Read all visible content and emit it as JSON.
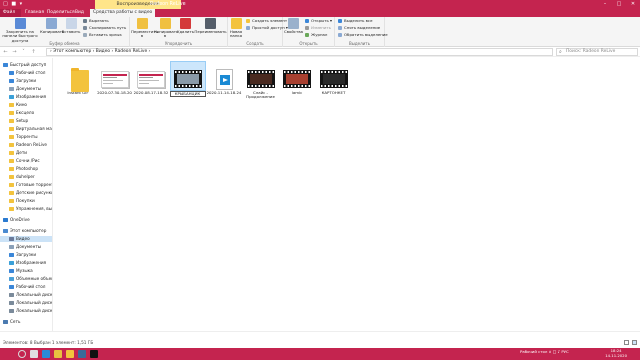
{
  "window": {
    "title": "Radeon ReLive",
    "context_header": "Воспроизведение",
    "quick_access": "□ ■ ▾",
    "controls": [
      "–",
      "□",
      "✕"
    ]
  },
  "tabs": [
    {
      "label": "Файл"
    },
    {
      "label": "Главная"
    },
    {
      "label": "Поделиться"
    },
    {
      "label": "Вид"
    },
    {
      "label": "Средства работы с видео"
    }
  ],
  "ribbon": {
    "groups": [
      {
        "label": "Буфер обмена",
        "items": [
          {
            "label": "Закрепить на панели быстрого доступа",
            "kind": "big",
            "color": "#5a8ad6"
          },
          {
            "label": "Копировать",
            "kind": "big",
            "color": "#8aa9d3"
          },
          {
            "label": "Вставить",
            "kind": "big",
            "color": "#c9d6e8"
          },
          {
            "label": "Вырезать",
            "kind": "small",
            "color": "#6a7a8a"
          },
          {
            "label": "Скопировать путь",
            "kind": "small",
            "color": "#7a8a9a"
          },
          {
            "label": "Вставить ярлык",
            "kind": "small",
            "color": "#9aaaba"
          }
        ]
      },
      {
        "label": "Упорядочить",
        "items": [
          {
            "label": "Переместить в",
            "kind": "big",
            "color": "#f0c040"
          },
          {
            "label": "Копировать в",
            "kind": "big",
            "color": "#f0c040"
          },
          {
            "label": "Удалить",
            "kind": "big",
            "color": "#d43a3a"
          },
          {
            "label": "Переименовать",
            "kind": "big",
            "color": "#555e6a"
          }
        ]
      },
      {
        "label": "Создать",
        "items": [
          {
            "label": "Новая папка",
            "kind": "big",
            "color": "#f3c33d"
          },
          {
            "label": "Создать элемент ▾",
            "kind": "small",
            "color": "#f3c33d"
          },
          {
            "label": "Простой доступ ▾",
            "kind": "small",
            "color": "#8aa9d3"
          }
        ]
      },
      {
        "label": "Открыть",
        "items": [
          {
            "label": "Свойства",
            "kind": "big",
            "color": "#9ab1cc"
          },
          {
            "label": "Открыть ▾",
            "kind": "small",
            "color": "#3a86d8"
          },
          {
            "label": "Изменить",
            "kind": "small",
            "color": "#999"
          },
          {
            "label": "Журнал",
            "kind": "small",
            "color": "#6aa85a"
          }
        ]
      },
      {
        "label": "Выделить",
        "items": [
          {
            "label": "Выделить все",
            "kind": "small",
            "color": "#3a86d8"
          },
          {
            "label": "Снять выделение",
            "kind": "small",
            "color": "#8aa9d3"
          },
          {
            "label": "Обратить выделение",
            "kind": "small",
            "color": "#8aa9d3"
          }
        ]
      }
    ]
  },
  "address": {
    "nav": [
      "←",
      "→",
      "˅",
      "↑"
    ],
    "path": "›  Этот компьютер  ›  Видео  ›  Radeon ReLive  ›",
    "search_placeholder": "Поиск: Radeon ReLive",
    "search_icon": "⌕"
  },
  "sidebar": [
    {
      "label": "Быстрый доступ",
      "color": "#3a86d8",
      "indent": 0
    },
    {
      "label": "Рабочий стол",
      "color": "#3a86d8",
      "indent": 1
    },
    {
      "label": "Загрузки",
      "color": "#3a86d8",
      "indent": 1
    },
    {
      "label": "Документы",
      "color": "#8aa0b8",
      "indent": 1
    },
    {
      "label": "Изображения",
      "color": "#3aa0d8",
      "indent": 1
    },
    {
      "label": "Кино",
      "color": "#f3c33d",
      "indent": 1
    },
    {
      "label": "Ексцело",
      "color": "#f3c33d",
      "indent": 1
    },
    {
      "label": "Setup",
      "color": "#f3c33d",
      "indent": 1
    },
    {
      "label": "Виртуальная маш",
      "color": "#f3c33d",
      "indent": 1
    },
    {
      "label": "Торренты",
      "color": "#f3c33d",
      "indent": 1
    },
    {
      "label": "Radeon ReLive",
      "color": "#f3c33d",
      "indent": 1
    },
    {
      "label": "Дети",
      "color": "#f3c33d",
      "indent": 1
    },
    {
      "label": "Сочни /Рис",
      "color": "#f3c33d",
      "indent": 1
    },
    {
      "label": "Photoshop",
      "color": "#f3c33d",
      "indent": 1
    },
    {
      "label": "duhelper",
      "color": "#f3c33d",
      "indent": 1
    },
    {
      "label": "Готовые торренты",
      "color": "#f3c33d",
      "indent": 1
    },
    {
      "label": "Детские рисунки",
      "color": "#f3c33d",
      "indent": 1
    },
    {
      "label": "Покупки",
      "color": "#f3c33d",
      "indent": 1
    },
    {
      "label": "Упражнения, высш",
      "color": "#f3c33d",
      "indent": 1
    },
    {
      "label": "OneDrive",
      "color": "#2a7ad0",
      "indent": 0,
      "gap": true
    },
    {
      "label": "Этот компьютер",
      "color": "#4a8ad0",
      "indent": 0,
      "gap": true
    },
    {
      "label": "Видео",
      "color": "#6a7a9a",
      "indent": 1,
      "selected": true
    },
    {
      "label": "Документы",
      "color": "#8aa0b8",
      "indent": 1
    },
    {
      "label": "Загрузки",
      "color": "#3a86d8",
      "indent": 1
    },
    {
      "label": "Изображения",
      "color": "#3aa0d8",
      "indent": 1
    },
    {
      "label": "Музыка",
      "color": "#3a86d8",
      "indent": 1
    },
    {
      "label": "Объемные объект",
      "color": "#4aa0d8",
      "indent": 1
    },
    {
      "label": "Рабочий стол",
      "color": "#3a86d8",
      "indent": 1
    },
    {
      "label": "Локальный диск (C",
      "color": "#7a8a9a",
      "indent": 1
    },
    {
      "label": "Локальный диск (D",
      "color": "#7a8a9a",
      "indent": 1
    },
    {
      "label": "Локальный диск (E",
      "color": "#7a8a9a",
      "indent": 1
    },
    {
      "label": "Сеть",
      "color": "#4a7ab0",
      "indent": 0,
      "gap": true
    }
  ],
  "files": [
    {
      "name": "Instant GIF",
      "type": "folder"
    },
    {
      "name": "2020.07.30-18.20",
      "type": "shot"
    },
    {
      "name": "2020.08.17-18.52",
      "type": "shot"
    },
    {
      "name": "КРЫБАНЦИК",
      "type": "film",
      "selected": true,
      "frame": "#8a9aa8"
    },
    {
      "name": "2020.11.14-18.24",
      "type": "mp4"
    },
    {
      "name": "Слайс - Продолжение",
      "type": "film",
      "frame": "#4a2a20"
    },
    {
      "name": "lamic",
      "type": "film",
      "frame": "#a84030"
    },
    {
      "name": "КАРТОНКЕТ",
      "type": "film",
      "frame": "#2a2a2a"
    }
  ],
  "status": {
    "text": "Элементов: 8   Выбран 1 элемент: 1,51 ГБ"
  },
  "taskbar": {
    "apps": [
      {
        "name": "start-button",
        "color": "#c4244f"
      },
      {
        "name": "search-icon",
        "color": "#d9d9d9"
      },
      {
        "name": "taskview-icon",
        "color": "#e0e0e0"
      },
      {
        "name": "edge-icon",
        "color": "#2a8ad8"
      },
      {
        "name": "chrome-icon",
        "color": "#e8c040"
      },
      {
        "name": "explorer-icon",
        "color": "#f3c33d"
      },
      {
        "name": "app-icon",
        "color": "#3a6a9a"
      },
      {
        "name": "amd-icon",
        "color": "#111111"
      }
    ],
    "tray": "Рабочий стол  ∧  □  ♪  РУС",
    "time": "18:24",
    "date": "14.11.2020"
  }
}
